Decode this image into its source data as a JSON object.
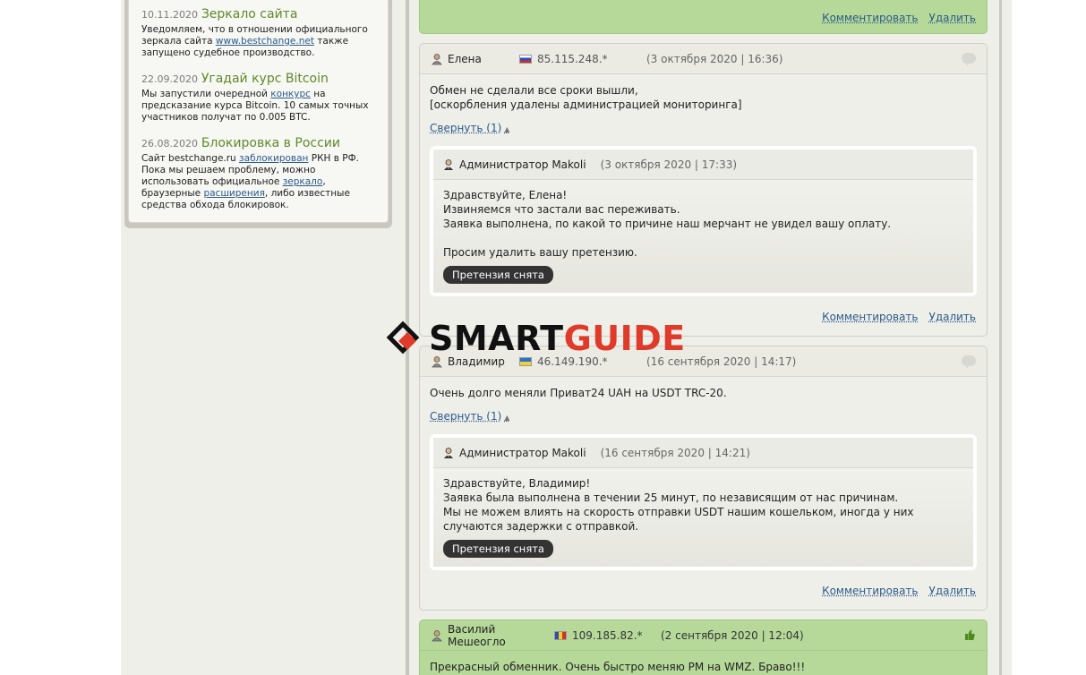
{
  "news": [
    {
      "date": "10.11.2020",
      "title": "Зеркало сайта",
      "text_1": "Уведомляем, что в отношении официального зеркала сайта ",
      "link_1": "www.bestchange.net",
      "text_2": " также запущено судебное производство."
    },
    {
      "date": "22.09.2020",
      "title": "Угадай курс Bitcoin",
      "text_1": "Мы запустили очередной ",
      "link_1": "конкурс",
      "text_2": " на предсказание курса Bitcoin. 10 самых точных участников получат по 0.005 BTC."
    },
    {
      "date": "26.08.2020",
      "title": "Блокировка в России",
      "text_1": "Сайт bestchange.ru ",
      "link_1": "заблокирован",
      "text_2": " РКН в РФ. Пока мы решаем проблему, можно использовать официальное ",
      "link_2": "зеркало",
      "text_3": ", браузерные ",
      "link_3": "расширения",
      "text_4": ", либо известные средства обхода блокировок."
    }
  ],
  "top_card": {
    "comment_label": "Комментировать",
    "delete_label": "Удалить"
  },
  "reviews": [
    {
      "author": "Елена",
      "ip": "85.115.248.*",
      "date": "(3 октября 2020 | 16:36)",
      "lines": [
        "Обмен не сделали все сроки вышли,",
        "[оскорбления удалены администрацией мониторинга]"
      ],
      "collapse_label": "Свернуть (1)",
      "reply": {
        "author": "Администратор Makoli",
        "date": "(3 октября 2020 | 17:33)",
        "lines": [
          "Здравствуйте, Елена!",
          "Извиняемся что застали вас переживать.",
          "Заявка выполнена, по какой то причине наш мерчант не увидел вашу оплату.",
          "",
          "Просим удалить вашу претензию."
        ],
        "badge": "Претензия снята"
      },
      "comment_label": "Комментировать",
      "delete_label": "Удалить"
    },
    {
      "author": "Владимир",
      "ip": "46.149.190.*",
      "date": "(16 сентября 2020 | 14:17)",
      "lines": [
        "Очень долго меняли Приват24 UAH на USDT TRC-20."
      ],
      "collapse_label": "Свернуть (1)",
      "reply": {
        "author": "Администратор Makoli",
        "date": "(16 сентября 2020 | 14:21)",
        "lines": [
          "Здравствуйте, Владимир!",
          "Заявка была выполнена в течении 25 минут, по независящим от нас причинам.",
          "Мы не можем влиять на скорость отправки USDT нашим кошельком, иногда у них случаются задержки с отправкой."
        ],
        "badge": "Претензия снята"
      },
      "comment_label": "Комментировать",
      "delete_label": "Удалить"
    },
    {
      "author": "Василий Мешеогло",
      "ip": "109.185.82.*",
      "date": "(2 сентября 2020 | 12:04)",
      "lines": [
        "Прекрасный обменник. Очень быстро меняю PM на WMZ. Браво!!!"
      ]
    }
  ],
  "watermark": {
    "part1": "SMART",
    "part2": "GUIDE"
  },
  "colors": {
    "positive_card": "#b6d99a",
    "link": "#2a5b8a",
    "news_title": "#5f8a2a",
    "watermark_red": "#e03a2a"
  }
}
